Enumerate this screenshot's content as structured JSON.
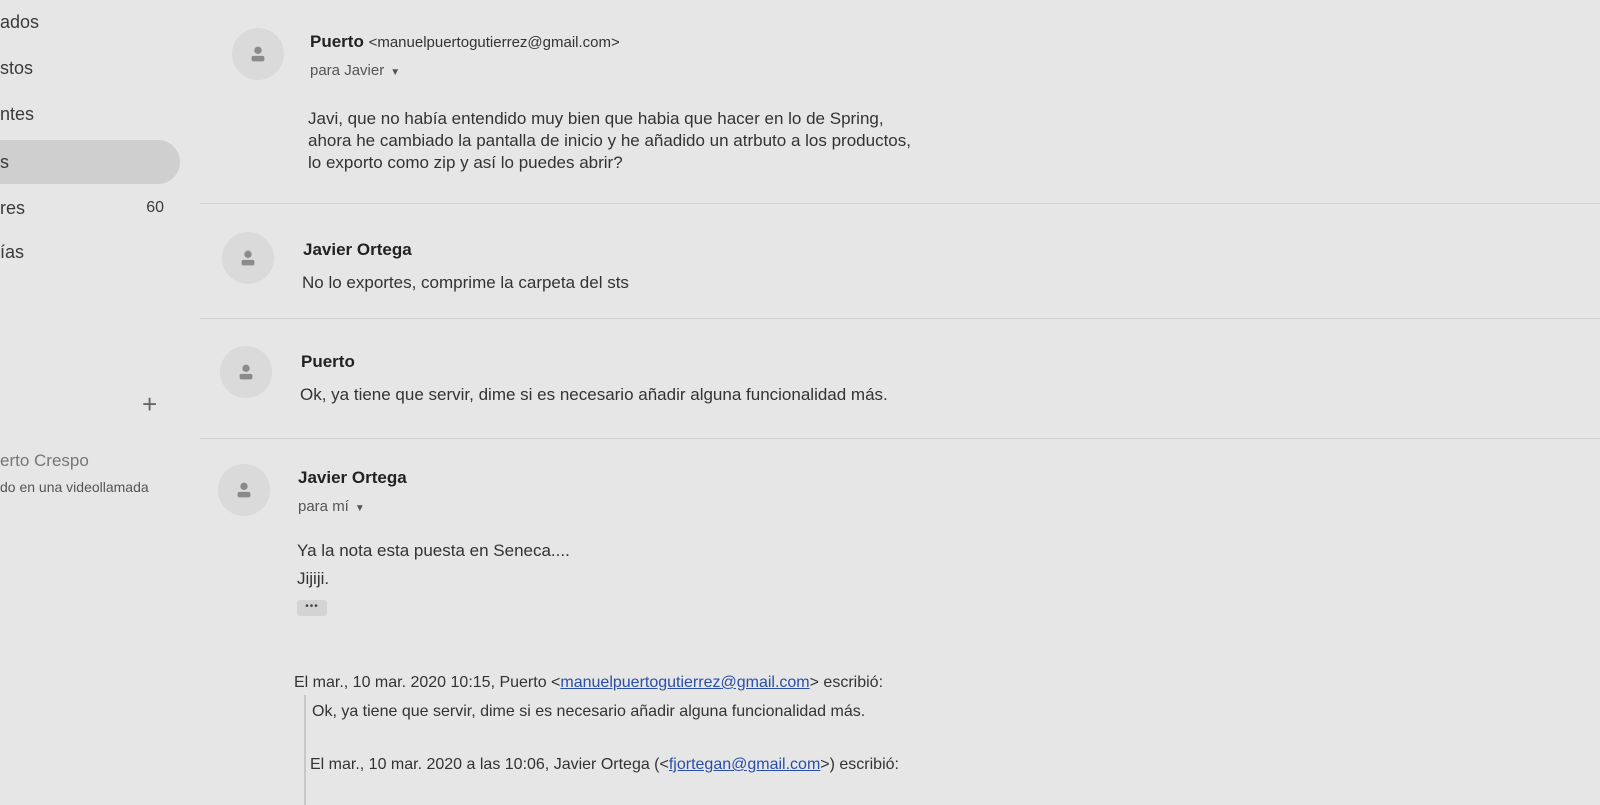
{
  "sidebar": {
    "items": [
      {
        "label": "ados",
        "count": ""
      },
      {
        "label": "stos",
        "count": ""
      },
      {
        "label": "ntes",
        "count": ""
      },
      {
        "label": "s",
        "count": ""
      },
      {
        "label": "res",
        "count": "60"
      },
      {
        "label": "ías",
        "count": ""
      }
    ],
    "add_icon": "+",
    "contact": {
      "name": "erto Crespo",
      "status": "do en una videollamada"
    }
  },
  "messages": [
    {
      "sender": "Puerto",
      "email": "<manuelpuertogutierrez@gmail.com>",
      "to": "para Javier",
      "body": [
        "Javi, que no había entendido muy bien que habia que hacer en lo de Spring,",
        "ahora he cambiado la pantalla de inicio y he añadido un atrbuto a los productos,",
        "lo exporto como zip y así lo puedes abrir?"
      ]
    },
    {
      "sender": "Javier Ortega",
      "body": [
        "No lo exportes, comprime la carpeta del sts"
      ]
    },
    {
      "sender": "Puerto",
      "body": [
        "Ok, ya tiene que servir, dime si es necesario añadir alguna funcionalidad más."
      ]
    },
    {
      "sender": "Javier Ortega",
      "to": "para mí",
      "body": [
        "Ya la nota esta puesta en Seneca....",
        "Jijiji."
      ],
      "more": "•••",
      "quote": {
        "header_prefix": "El mar., 10 mar. 2020 10:15, Puerto <",
        "header_link": "manuelpuertogutierrez@gmail.com",
        "header_suffix": "> escribió:",
        "line": "Ok, ya tiene que servir, dime si es necesario añadir alguna funcionalidad más.",
        "nested_prefix": "El mar., 10 mar. 2020 a las 10:06, Javier Ortega (<",
        "nested_link": "fjortegan@gmail.com",
        "nested_suffix": ">) escribió:"
      }
    }
  ],
  "icons": {
    "avatar": "person-icon",
    "caret": "caret-down-icon"
  }
}
